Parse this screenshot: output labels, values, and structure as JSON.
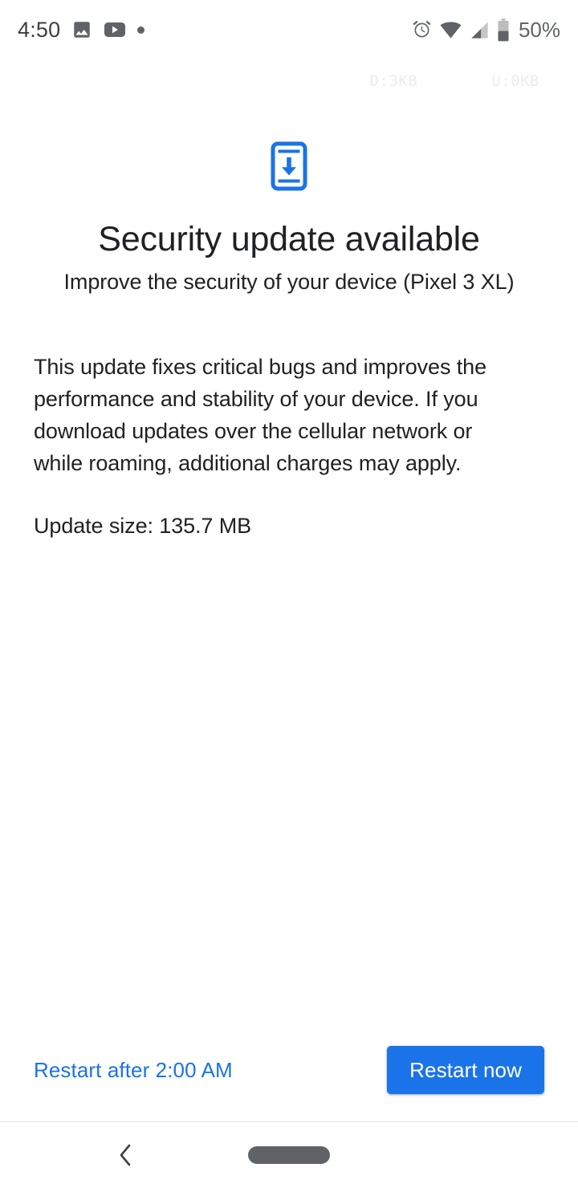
{
  "status_bar": {
    "time": "4:50",
    "battery_label": "50%",
    "icons": {
      "photos": "photo-notification-icon",
      "youtube": "youtube-notification-icon",
      "more": "more-notifications-dot",
      "alarm": "alarm-icon",
      "wifi": "wifi-icon",
      "cellular": "cellular-signal-icon",
      "battery": "battery-icon"
    },
    "battery_level_percent": 50
  },
  "data_speed": {
    "download": "D:3KB",
    "upload": "U:0KB"
  },
  "update": {
    "icon_name": "system-update-phone-download-icon",
    "title": "Security update available",
    "subtitle": "Improve the security of your device (Pixel 3 XL)",
    "description": "This update fixes critical bugs and improves the performance and stability of your device. If you download updates over the cellular network or while roaming, additional charges may apply.",
    "size_label": "Update size: 135.7 MB"
  },
  "actions": {
    "schedule_label": "Restart after 2:00 AM",
    "restart_label": "Restart now"
  },
  "nav_bar": {
    "back": "back-chevron-icon",
    "home": "home-pill-handle"
  },
  "colors": {
    "accent_blue": "#1a73e8",
    "icon_blue": "#1a73e8",
    "text_primary": "#202124",
    "status_icon_gray": "#5f6368",
    "data_speed_gray": "#ececec",
    "divider": "#e3e3e3",
    "background": "#ffffff"
  }
}
